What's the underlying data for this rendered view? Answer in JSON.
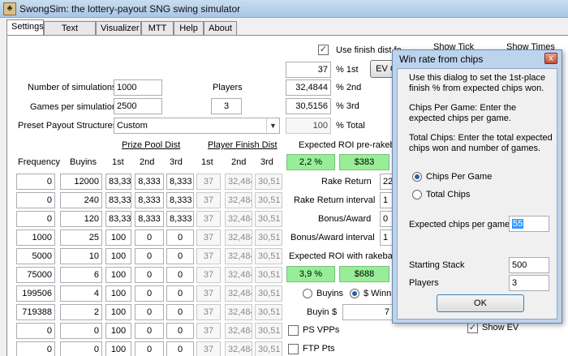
{
  "window": {
    "title": "SwongSim: the lottery-payout SNG swing simulator"
  },
  "tabs": [
    {
      "label": "Settings",
      "active": true
    },
    {
      "label": "Text Output"
    },
    {
      "label": "Visualizer"
    },
    {
      "label": "MTT"
    },
    {
      "label": "Help"
    },
    {
      "label": "About"
    }
  ],
  "settings": {
    "use_finish_dist_label": "Use finish dist fo",
    "use_finish_dist_checked": true,
    "show_ticks_label": "Show Tick",
    "show_times_label": "Show Times",
    "ev_button_label": "EV C",
    "num_sims_label": "Number of simulations",
    "num_sims_value": "1000",
    "games_per_sim_label": "Games per simulation",
    "games_per_sim_value": "2500",
    "players_label": "Players",
    "players_value": "3",
    "preset_label": "Preset Payout Structures",
    "preset_value": "Custom",
    "pct_1st_value": "37",
    "pct_1st_label": "% 1st",
    "pct_2nd_value": "32,4844",
    "pct_2nd_label": "% 2nd",
    "pct_3rd_value": "30,5156",
    "pct_3rd_label": "% 3rd",
    "pct_total_value": "100",
    "pct_total_label": "% Total"
  },
  "table": {
    "prize_pool_header": "Prize Pool Dist",
    "player_finish_header": "Player Finish Dist",
    "columns": [
      "Frequency",
      "Buyins",
      "1st",
      "2nd",
      "3rd",
      "1st",
      "2nd",
      "3rd"
    ],
    "rows": [
      {
        "freq": "0",
        "buyins": "12000",
        "p1": "83,33",
        "p2": "8,333",
        "p3": "8,333",
        "f1": "37",
        "f2": "32,484",
        "f3": "30,51"
      },
      {
        "freq": "0",
        "buyins": "240",
        "p1": "83,33",
        "p2": "8,333",
        "p3": "8,333",
        "f1": "37",
        "f2": "32,484",
        "f3": "30,51"
      },
      {
        "freq": "0",
        "buyins": "120",
        "p1": "83,33",
        "p2": "8,333",
        "p3": "8,333",
        "f1": "37",
        "f2": "32,484",
        "f3": "30,51"
      },
      {
        "freq": "1000",
        "buyins": "25",
        "p1": "100",
        "p2": "0",
        "p3": "0",
        "f1": "37",
        "f2": "32,484",
        "f3": "30,51"
      },
      {
        "freq": "5000",
        "buyins": "10",
        "p1": "100",
        "p2": "0",
        "p3": "0",
        "f1": "37",
        "f2": "32,484",
        "f3": "30,51"
      },
      {
        "freq": "75000",
        "buyins": "6",
        "p1": "100",
        "p2": "0",
        "p3": "0",
        "f1": "37",
        "f2": "32,484",
        "f3": "30,51"
      },
      {
        "freq": "199506",
        "buyins": "4",
        "p1": "100",
        "p2": "0",
        "p3": "0",
        "f1": "37",
        "f2": "32,484",
        "f3": "30,51"
      },
      {
        "freq": "719388",
        "buyins": "2",
        "p1": "100",
        "p2": "0",
        "p3": "0",
        "f1": "37",
        "f2": "32,484",
        "f3": "30,51"
      },
      {
        "freq": "0",
        "buyins": "0",
        "p1": "100",
        "p2": "0",
        "p3": "0",
        "f1": "37",
        "f2": "32,484",
        "f3": "30,51"
      },
      {
        "freq": "0",
        "buyins": "0",
        "p1": "100",
        "p2": "0",
        "p3": "0",
        "f1": "37",
        "f2": "32,484",
        "f3": "30,51"
      }
    ]
  },
  "roi": {
    "pre_rakeback_label": "Expected ROI pre-rakeback",
    "pre_pct": "2,2 %",
    "pre_amount": "$383",
    "rake_return_label": "Rake Return",
    "rake_return_value": "22",
    "rake_return_interval_label": "Rake Return interval",
    "rake_return_interval_value": "1",
    "bonus_label": "Bonus/Award",
    "bonus_value": "0",
    "bonus_interval_label": "Bonus/Award interval",
    "bonus_interval_value": "1",
    "with_rakeback_label": "Expected ROI with rakeba",
    "with_pct": "3,9 %",
    "with_amount": "$688",
    "buyins_radio_label": "Buyins",
    "winnings_radio_label": "$ Winni",
    "buyin_label": "Buyin",
    "buyin_dollar": "$",
    "buyin_value": "7",
    "ps_vpps_label": "PS VPPs",
    "ftp_pts_label": "FTP Pts",
    "show_ev_label": "Show EV",
    "show_ev_checked": true
  },
  "dialog": {
    "title": "Win rate from chips",
    "close_glyph": "x",
    "intro": "Use this dialog to set the  1st-place finish % from expected chips won.",
    "cpg_help": "Chips Per Game:  Enter the expected chips per game.",
    "total_help": "Total Chips:  Enter the total expected chips won and number of games.",
    "radio_cpg": "Chips Per Game",
    "radio_total": "Total Chips",
    "expected_label": "Expected chips per game",
    "expected_value": "55",
    "starting_stack_label": "Starting Stack",
    "starting_stack_value": "500",
    "players_label": "Players",
    "players_value": "3",
    "ok_label": "OK"
  },
  "colors": {
    "green_field": "#98ee98",
    "title_bar": "#bcd3ec"
  }
}
